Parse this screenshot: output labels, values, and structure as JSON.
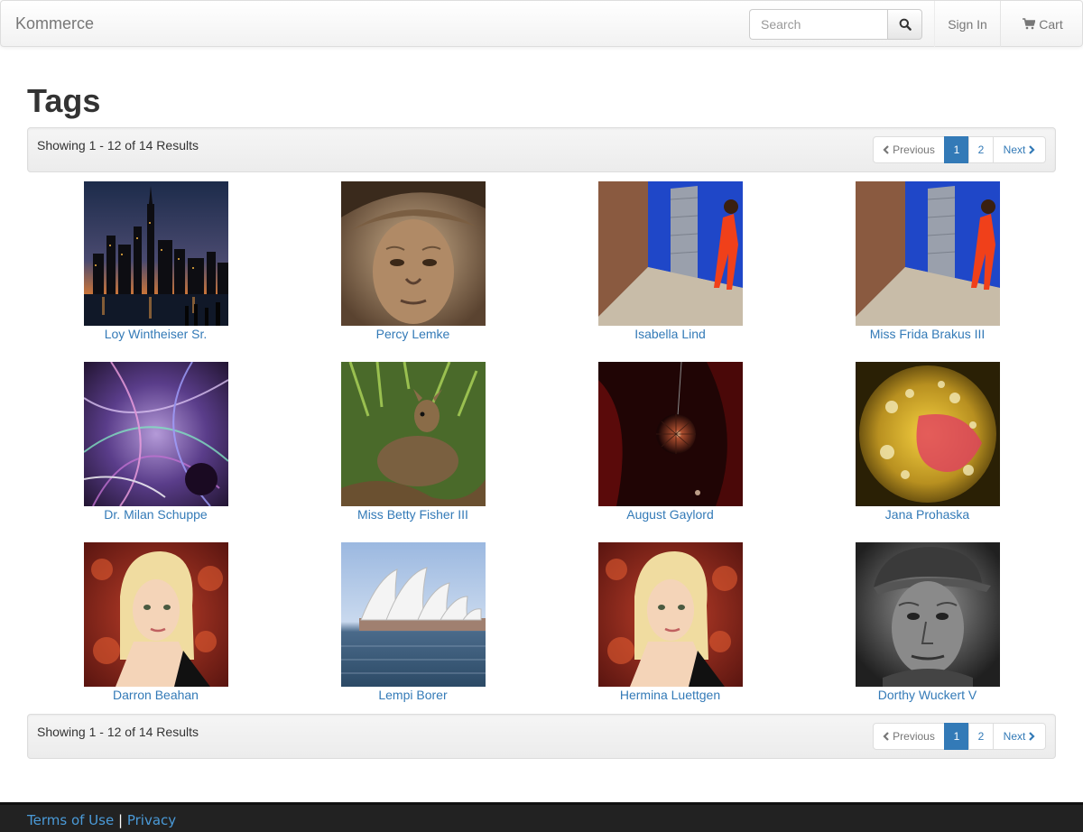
{
  "navbar": {
    "brand": "Kommerce",
    "search_placeholder": "Search",
    "sign_in": "Sign In",
    "cart": "Cart"
  },
  "page": {
    "title": "Tags"
  },
  "pagination": {
    "results_text": "Showing 1 - 12 of 14 Results",
    "previous": "Previous",
    "pages": [
      "1",
      "2"
    ],
    "active_page": "1",
    "next": "Next"
  },
  "products": [
    {
      "name": "Loy Wintheiser Sr.",
      "image": "city-skyline-night"
    },
    {
      "name": "Percy Lemke",
      "image": "elderly-woman-portrait-sepia"
    },
    {
      "name": "Isabella Lind",
      "image": "woman-red-outfit-blue-wall"
    },
    {
      "name": "Miss Frida Brakus III",
      "image": "woman-red-outfit-blue-wall"
    },
    {
      "name": "Dr. Milan Schuppe",
      "image": "abstract-purple-swirls"
    },
    {
      "name": "Miss Betty Fisher III",
      "image": "deer-in-forest"
    },
    {
      "name": "August Gaylord",
      "image": "disco-ball-red"
    },
    {
      "name": "Jana Prohaska",
      "image": "oil-bubbles-yellow"
    },
    {
      "name": "Darron Beahan",
      "image": "blonde-woman-autumn-leaves"
    },
    {
      "name": "Lempi Borer",
      "image": "sydney-opera-house"
    },
    {
      "name": "Hermina Luettgen",
      "image": "blonde-woman-autumn-leaves"
    },
    {
      "name": "Dorthy Wuckert V",
      "image": "old-man-cap-bw"
    }
  ],
  "footer": {
    "terms": "Terms of Use",
    "separator": "|",
    "privacy": "Privacy"
  }
}
